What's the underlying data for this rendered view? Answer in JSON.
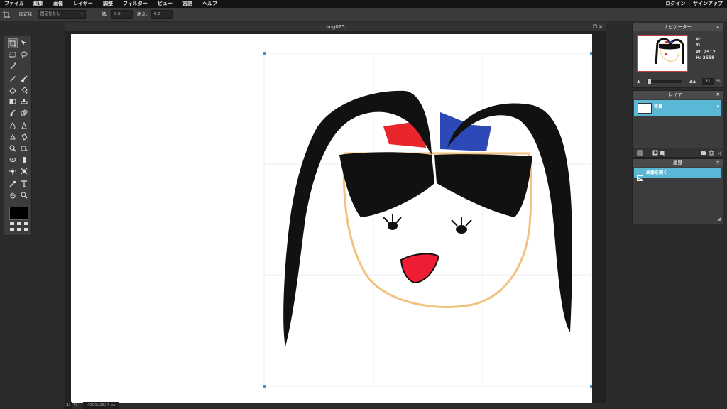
{
  "menu": {
    "items": [
      "ファイル",
      "編集",
      "画像",
      "レイヤー",
      "調整",
      "フィルター",
      "ビュー",
      "言語",
      "ヘルプ"
    ],
    "login": "ログイン",
    "separator": "|",
    "signup": "サインアップ"
  },
  "options": {
    "fixed_label": "固定化：",
    "fixed_value": "固定化なし",
    "width_label": "幅：",
    "width_value": "0.0",
    "height_label": "高さ：",
    "height_value": "0.0"
  },
  "document": {
    "title": "img025",
    "zoom": "31",
    "zoom_unit": "%",
    "size": "4000x2824 px"
  },
  "navigator": {
    "title": "ナビゲーター",
    "x_label": "X:",
    "y_label": "Y:",
    "w_label": "W:",
    "w_value": "2512",
    "h_label": "H:",
    "h_value": "2558",
    "zoom": "31",
    "zoom_unit": "%"
  },
  "layers": {
    "title": "レイヤー",
    "items": [
      {
        "name": "背景"
      }
    ]
  },
  "history": {
    "title": "履歴",
    "items": [
      {
        "name": "画像を開く"
      }
    ]
  },
  "colors": {
    "accent": "#5ab8d6",
    "foreground": "#000000"
  },
  "icons": [
    "crop-icon",
    "move-icon",
    "marquee-icon",
    "lasso-icon",
    "magic-wand-icon",
    "pencil-icon",
    "brush-icon",
    "eraser-icon",
    "bucket-icon",
    "gradient-icon",
    "stamp-icon",
    "color-replace-icon",
    "drawing-icon",
    "blur-icon",
    "sharpen-icon",
    "smudge-icon",
    "sponge-icon",
    "dodge-icon",
    "burn-icon",
    "red-eye-icon",
    "spot-heal-icon",
    "bloat-icon",
    "pinch-icon",
    "eyedropper-icon",
    "type-icon",
    "hand-icon",
    "zoom-icon"
  ]
}
